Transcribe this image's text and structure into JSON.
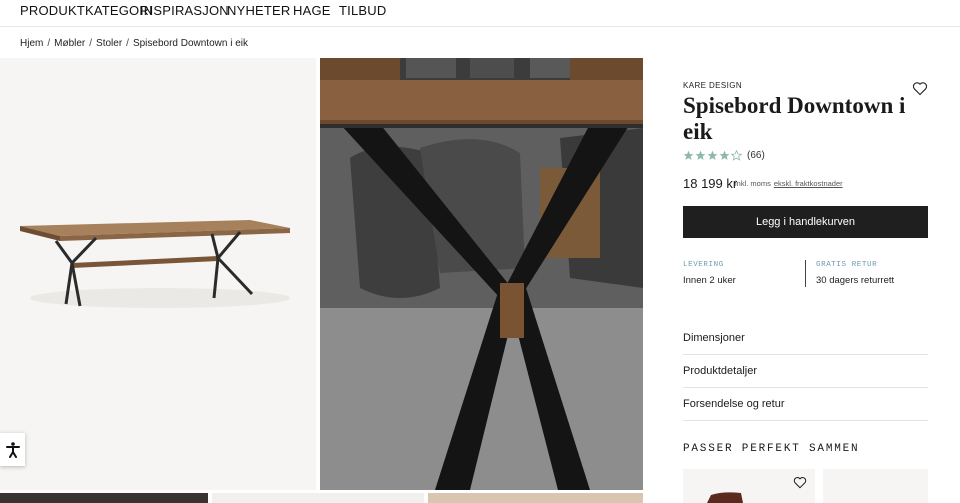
{
  "nav": {
    "items": [
      {
        "label": "PRODUKTKATEGORI"
      },
      {
        "label": "INSPIRASJON"
      },
      {
        "label": "NYHETER"
      },
      {
        "label": "HAGE"
      },
      {
        "label": "TILBUD"
      }
    ]
  },
  "breadcrumb": {
    "items": [
      "Hjem",
      "Møbler",
      "Stoler",
      "Spisebord Downtown i eik"
    ],
    "separator": "/"
  },
  "product": {
    "brand": "KARE DESIGN",
    "title": "Spisebord Downtown i eik",
    "rating": 4.5,
    "rating_max": 5,
    "review_count": "(66)",
    "price": "18 199 kr",
    "price_note": "inkl. moms",
    "shipping_link": "ekskl. fraktkostnader",
    "cart_button": "Legg i handlekurven",
    "delivery": {
      "label": "LEVERING",
      "value": "Innen 2 uker"
    },
    "returns": {
      "label": "GRATIS RETUR",
      "value": "30 dagers returrett"
    },
    "accordion": [
      "Dimensjoner",
      "Produktdetaljer",
      "Forsendelse og retur"
    ],
    "matches_title": "PASSER PERFEKT SAMMEN"
  },
  "colors": {
    "star": "#8fb9ad",
    "button_bg": "#1f1f1f",
    "info_label": "#6a9bb0",
    "image_bg": "#f6f5f3"
  },
  "icons": [
    "heart-icon",
    "star-icon",
    "accessibility-icon"
  ]
}
